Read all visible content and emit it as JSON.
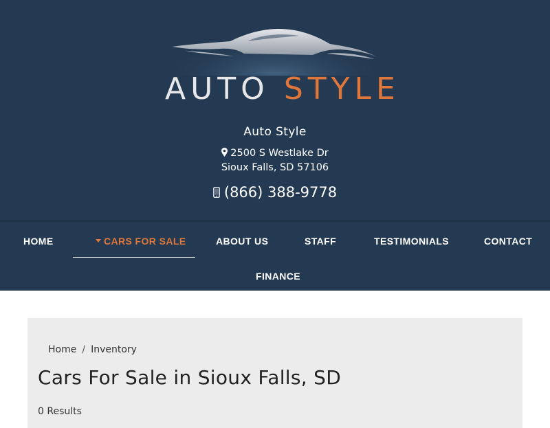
{
  "logo": {
    "word_auto": "AUTO",
    "word_style": "STYLE"
  },
  "dealer": {
    "name": "Auto Style",
    "address_line1": "2500 S Westlake Dr",
    "address_line2": "Sioux Falls, SD 57106",
    "phone": "(866) 388-9778",
    "address_icon": "map-pin-icon",
    "phone_icon": "mobile-phone-icon"
  },
  "nav": {
    "items": [
      {
        "label": "HOME"
      },
      {
        "label": "CARS FOR SALE",
        "active": true
      },
      {
        "label": "ABOUT US"
      },
      {
        "label": "STAFF"
      },
      {
        "label": "TESTIMONIALS"
      },
      {
        "label": "CONTACT"
      },
      {
        "label": "FINANCE"
      }
    ]
  },
  "breadcrumb": {
    "home": "Home",
    "separator": "/",
    "current": "Inventory"
  },
  "page": {
    "title": "Cars For Sale in Sioux Falls, SD",
    "results": "0 Results"
  },
  "colors": {
    "header_bg": "#243a52",
    "accent": "#e0773a",
    "content_bg": "#ececec"
  }
}
